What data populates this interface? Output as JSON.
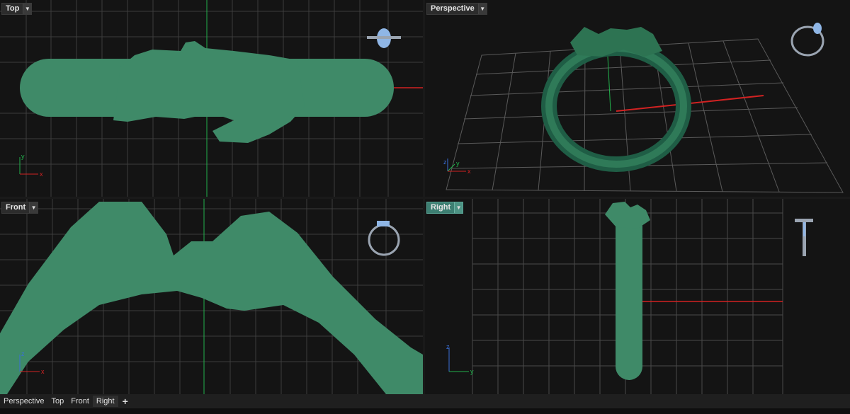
{
  "viewports": {
    "top": {
      "label": "Top"
    },
    "perspective": {
      "label": "Perspective"
    },
    "front": {
      "label": "Front"
    },
    "right": {
      "label": "Right"
    }
  },
  "dropdown_icon": "chevron-down-icon",
  "axes": {
    "top": [
      "x",
      "y"
    ],
    "front": [
      "x",
      "z"
    ],
    "right": [
      "y",
      "z"
    ],
    "perspective": [
      "x",
      "y",
      "z"
    ]
  },
  "bottom_tabs": [
    "Perspective",
    "Top",
    "Front",
    "Right"
  ],
  "add_tab_label": "+",
  "active_viewport": "Right",
  "colors": {
    "viewport_bg": "#141414",
    "grid": "#3d3d3d",
    "axis_x": "#d22222",
    "axis_y": "#22b14c",
    "axis_z": "#3a6fd8",
    "model_green": "#3f8a68",
    "model_dark_green": "#1f5d45",
    "active_label": "#3d7f72"
  }
}
